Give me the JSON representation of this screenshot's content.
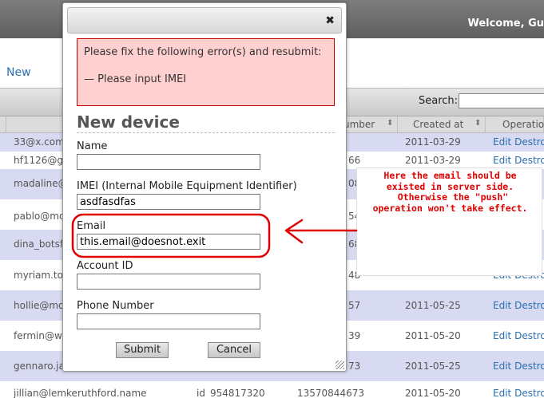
{
  "header": {
    "welcome": "Welcome, Gu"
  },
  "toolbar": {
    "new_label": "New"
  },
  "search": {
    "label": "Search:",
    "value": ""
  },
  "table": {
    "columns": [
      {
        "label": "umber"
      },
      {
        "label": "Created at"
      },
      {
        "label": "Operation"
      }
    ],
    "rows": [
      {
        "email": "33@x.com",
        "number": "",
        "date": "2011-03-29",
        "edit": "Edit",
        "destroy": "Destro"
      },
      {
        "email": "hf1126@g",
        "number": "66",
        "date": "2011-03-29",
        "edit": "Edit",
        "destroy": "Destro"
      },
      {
        "email": "madaline@",
        "number": "08",
        "date": "",
        "edit": "",
        "destroy": ""
      },
      {
        "email": "pablo@mc",
        "number": "54",
        "date": "",
        "edit": "",
        "destroy": ""
      },
      {
        "email": "dina_botsf",
        "number": "68",
        "date": "",
        "edit": "",
        "destroy": ""
      },
      {
        "email": "myriam.tor",
        "number": "48",
        "date": "",
        "edit": "Edit",
        "destroy": "Destro"
      },
      {
        "email": "hollie@mo",
        "number": "57",
        "date": "2011-05-25",
        "edit": "Edit",
        "destroy": "Destro"
      },
      {
        "email": "fermin@wa",
        "number": "39",
        "date": "2011-05-20",
        "edit": "Edit",
        "destroy": "Destro"
      },
      {
        "email": "gennaro.ja",
        "number": "73",
        "date": "2011-05-25",
        "edit": "Edit",
        "destroy": "Destro"
      },
      {
        "email": "jillian@lemkeruthford.name",
        "number": "id_954817320",
        "number2": "13570844673",
        "date": "2011-05-20",
        "edit": "Edit",
        "destroy": "Destro"
      }
    ]
  },
  "dialog": {
    "close_icon": "close-x-icon",
    "error": {
      "message": "Please fix the following error(s) and resubmit:",
      "item": "— Please input IMEI"
    },
    "title": "New device",
    "fields": {
      "name": {
        "label": "Name",
        "value": ""
      },
      "imei": {
        "label": "IMEI (Internal Mobile Equipment Identifier)",
        "value": "asdfasdfas"
      },
      "email": {
        "label": "Email",
        "value": "this.email@doesnot.exit"
      },
      "account_id": {
        "label": "Account ID",
        "value": ""
      },
      "phone": {
        "label": "Phone Number",
        "value": ""
      }
    },
    "submit_label": "Submit",
    "cancel_label": "Cancel"
  },
  "annotation": {
    "text": "Here the email should be\nexisted in server side.\n Otherwise the \"push\"\noperation won't take effect.",
    "color": "#e00000"
  },
  "colors": {
    "row_alt": "#d7daf0",
    "link": "#2a6fb0",
    "error_bg": "#ffd0d0",
    "error_border": "#c40000"
  }
}
